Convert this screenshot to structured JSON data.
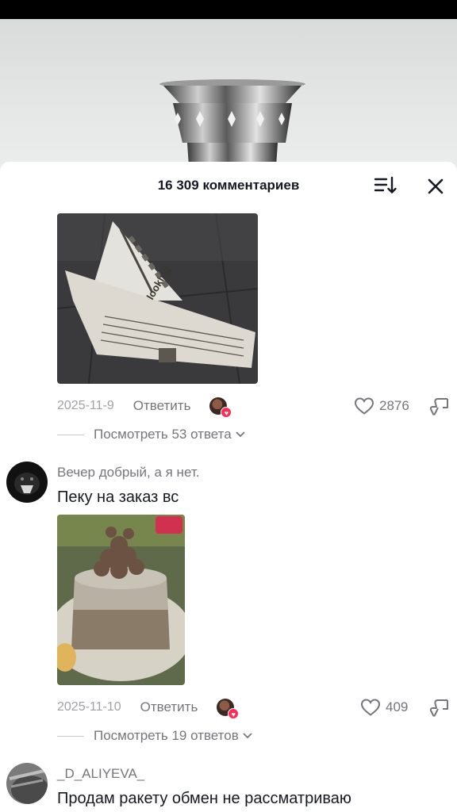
{
  "sheet": {
    "title": "16 309 комментариев"
  },
  "comments": [
    {
      "image": "paper-hat-photo",
      "date": "2025-11-9",
      "reply_label": "Ответить",
      "likes": "2876",
      "view_replies": "Посмотреть 53 ответа"
    },
    {
      "username": "Вечер добрый, а я нет.",
      "text": "Пеку на заказ вс",
      "image": "mud-cake-photo",
      "date": "2025-11-10",
      "reply_label": "Ответить",
      "likes": "409",
      "view_replies": "Посмотреть 19 ответов"
    },
    {
      "username": "_D_ALIYEVA_",
      "text": "Продам ракету обмен не рассматриваю"
    }
  ],
  "icons": {
    "sort": "sort-icon",
    "close": "close-icon",
    "like": "heart-outline-icon",
    "dislike": "dislike-icon",
    "chevron": "chevron-down-icon"
  },
  "colors": {
    "sheet_bg": "#ffffff",
    "text_primary": "#161823",
    "text_secondary": "#75767c",
    "accent": "#fe2c55"
  }
}
